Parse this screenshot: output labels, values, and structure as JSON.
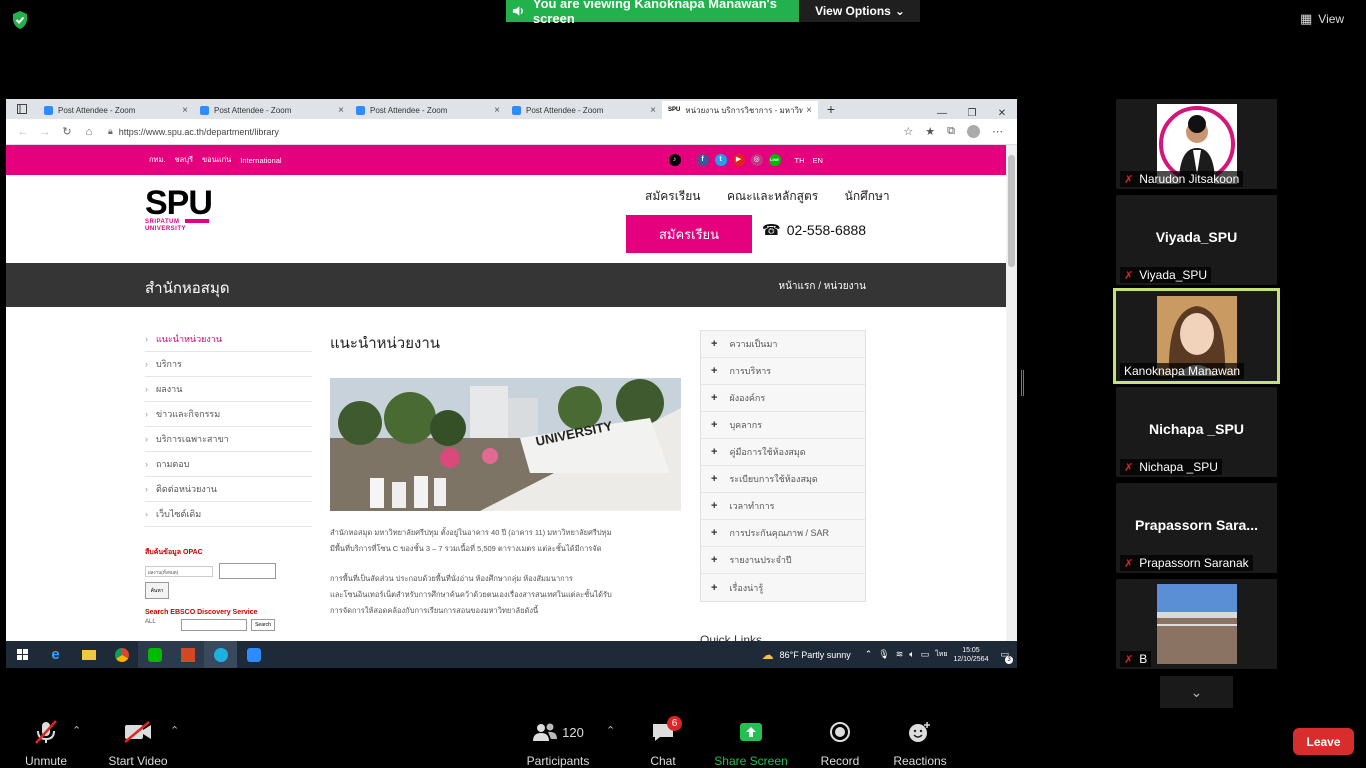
{
  "zoom": {
    "viewing_banner": "You are viewing Kanoknapa Manawan's screen",
    "view_options": "View Options",
    "view_label": "View",
    "toolbar": {
      "unmute": "Unmute",
      "start_video": "Start Video",
      "participants": "Participants",
      "participants_count": "120",
      "chat": "Chat",
      "chat_badge": "6",
      "share_screen": "Share Screen",
      "record": "Record",
      "reactions": "Reactions",
      "leave": "Leave"
    },
    "gallery": [
      {
        "name": "Narudon Jitsakoon",
        "big": ""
      },
      {
        "name": "Viyada_SPU",
        "big": "Viyada_SPU"
      },
      {
        "name": "Kanoknapa Manawan",
        "big": ""
      },
      {
        "name": "Nichapa _SPU",
        "big": "Nichapa _SPU"
      },
      {
        "name": "Prapassorn Saranak",
        "big": "Prapassorn  Sara..."
      },
      {
        "name": "B",
        "big": ""
      }
    ]
  },
  "browser": {
    "tabs": [
      {
        "label": "Post Attendee - Zoom"
      },
      {
        "label": "Post Attendee - Zoom"
      },
      {
        "label": "Post Attendee - Zoom"
      },
      {
        "label": "Post Attendee - Zoom"
      },
      {
        "label": "หน่วยงาน บริการวิชาการ - มหาวิทยาลั"
      }
    ],
    "url": "https://www.spu.ac.th/department/library"
  },
  "site": {
    "top_links": [
      "กทม.",
      "ชลบุรี",
      "ขอนแก่น",
      "International"
    ],
    "lang": [
      "TH",
      "EN"
    ],
    "logo": "SPU",
    "logo_sub1": "SRIPATUM",
    "logo_sub2": "UNIVERSITY",
    "nav": [
      "สมัครเรียน",
      "คณะและหลักสูตร",
      "นักศึกษา"
    ],
    "apply_button": "สมัครเรียน",
    "phone": "02-558-6888",
    "dept_title": "สำนักหอสมุด",
    "breadcrumb": "หน้าแรก / หน่วยงาน",
    "sidebar": [
      "แนะนำหน่วยงาน",
      "บริการ",
      "ผลงาน",
      "ข่าวและกิจกรรม",
      "บริการเฉพาะสาขา",
      "ถามตอบ",
      "ติดต่อหน่วยงาน",
      "เว็บไซต์เดิม"
    ],
    "opac_title": "สืบค้นข้อมูล OPAC",
    "opac_select": "ผลงาน(ทั้งหมด)",
    "opac_button": "ค้นหา",
    "ebsco_title": "Search EBSCO Discovery Service",
    "ebsco_select": "ALL",
    "ebsco_button": "Search",
    "main_title": "แนะนำหน่วยงาน",
    "para1a": "สำนักหอสมุด มหาวิทยาลัยศรีปทุม ตั้งอยู่ในอาคาร 40 ปี (อาคาร 11) มหาวิทยาลัยศรีปทุม",
    "para1b": "มีพื้นที่บริการที่โซน C ของชั้น 3 – 7 รวมเนื้อที่ 5,509 ตารางเมตร แต่ละชั้นได้มีการจัด",
    "para2a": "การพื้นที่เป็นสัดส่วน ประกอบด้วยพื้นที่นั่งอ่าน ห้องศึกษากลุ่ม ห้องสัมมนาการ",
    "para2b": "และโซนอินเทอร์เน็ตสำหรับการศึกษาค้นคว้าด้วยตนเองเรื่องสารสนเทศในแต่ละชั้นได้รับ",
    "para2c": "การจัดการให้สอดคล้องกับการเรียนการสอนของมหาวิทยาลัยดังนี้",
    "right_menu": [
      "ความเป็นมา",
      "การบริหาร",
      "ผังองค์กร",
      "บุคลากร",
      "คู่มือการใช้ห้องสมุด",
      "ระเบียบการใช้ห้องสมุด",
      "เวลาทำการ",
      "การประกันคุณภาพ / SAR",
      "รายงานประจำปี",
      "เรื่องน่ารู้"
    ],
    "quick_links": "Quick Links"
  },
  "taskbar": {
    "weather": "86°F  Partly sunny",
    "lang": "ไทย",
    "time": "15:05",
    "date": "12/10/2564",
    "notif": "3"
  },
  "colors": {
    "brand": "#e5007d",
    "zoom_green": "#23b14d",
    "leave": "#d92d2d"
  }
}
